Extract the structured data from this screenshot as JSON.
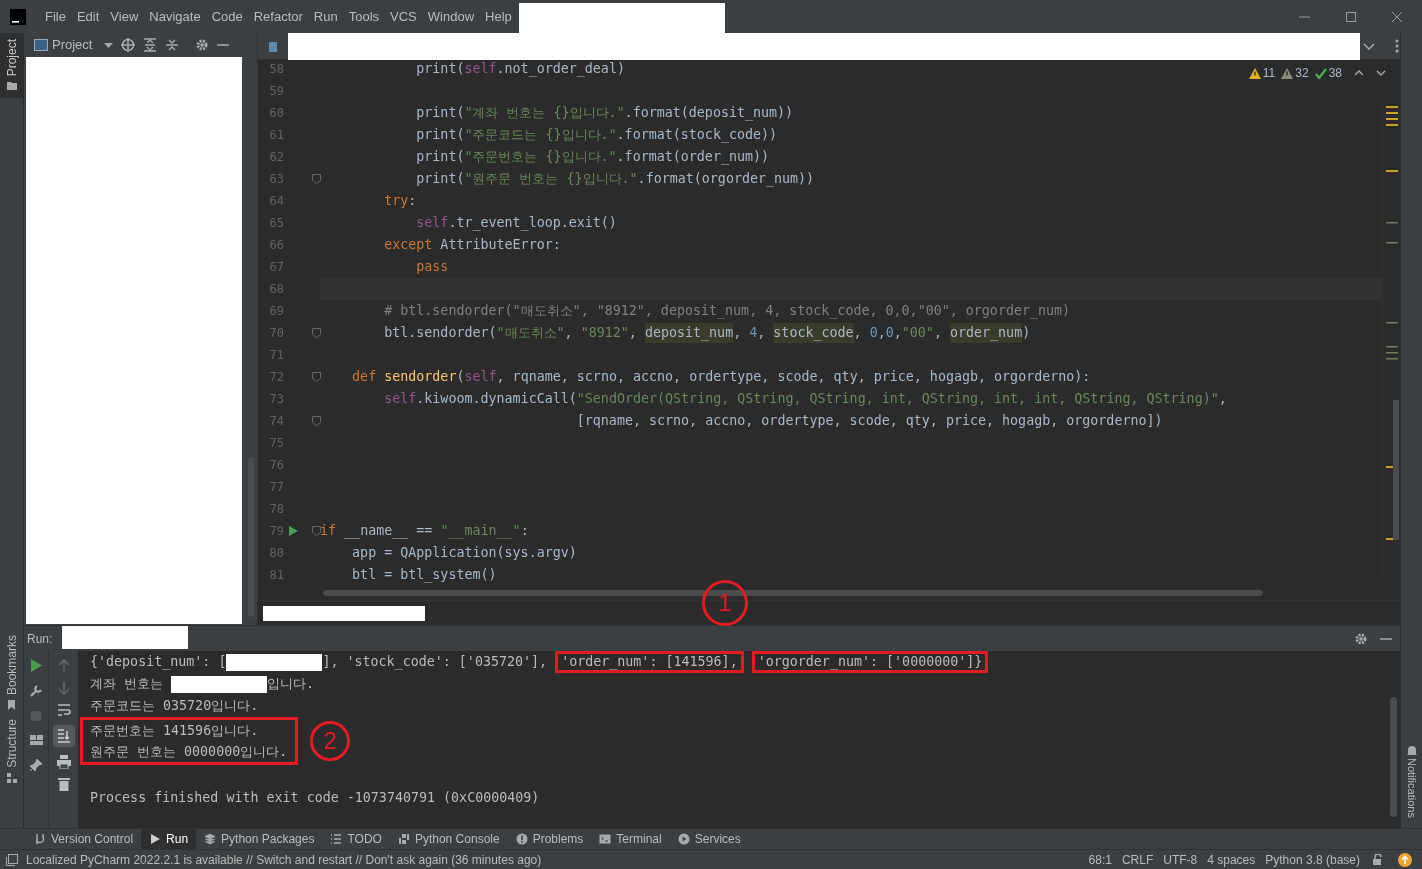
{
  "menu": [
    {
      "label": "File"
    },
    {
      "label": "Edit"
    },
    {
      "label": "View"
    },
    {
      "label": "Navigate"
    },
    {
      "label": "Code"
    },
    {
      "label": "Refactor"
    },
    {
      "label": "Run"
    },
    {
      "label": "Tools"
    },
    {
      "label": "VCS"
    },
    {
      "label": "Window"
    },
    {
      "label": "Help"
    }
  ],
  "left_tabs": [
    {
      "label": "Project",
      "selected": true
    }
  ],
  "left_bottom_tabs": [
    {
      "label": "Bookmarks",
      "selected": false
    },
    {
      "label": "Structure",
      "selected": false
    }
  ],
  "right_tabs": [
    {
      "label": "Notifications",
      "selected": false
    }
  ],
  "project_panel": {
    "title": "Project"
  },
  "inspections": [
    {
      "kind": "warning",
      "count": "11",
      "color": "#e0b020"
    },
    {
      "kind": "weak",
      "count": "32",
      "color": "#8c8a78"
    },
    {
      "kind": "typo",
      "count": "38",
      "color": "#4caf50"
    }
  ],
  "code_lines": [
    {
      "number": "58",
      "fold": false,
      "run": false,
      "current": false,
      "tokens": [
        {
          "kind": "plain",
          "text": "            print("
        },
        {
          "kind": "self",
          "text": "self"
        },
        {
          "kind": "plain",
          "text": ".not_order_deal)"
        }
      ]
    },
    {
      "number": "59",
      "fold": false,
      "run": false,
      "current": false
    },
    {
      "number": "60",
      "fold": false,
      "run": false,
      "current": false,
      "tokens": [
        {
          "kind": "plain",
          "text": "            print("
        },
        {
          "kind": "str",
          "text": "\"계좌 번호는 {}입니다.\""
        },
        {
          "kind": "plain",
          "text": ".format(deposit_num))"
        }
      ]
    },
    {
      "number": "61",
      "fold": false,
      "run": false,
      "current": false,
      "tokens": [
        {
          "kind": "plain",
          "text": "            print("
        },
        {
          "kind": "str",
          "text": "\"주문코드는 {}입니다.\""
        },
        {
          "kind": "plain",
          "text": ".format(stock_code))"
        }
      ]
    },
    {
      "number": "62",
      "fold": false,
      "run": false,
      "current": false,
      "tokens": [
        {
          "kind": "plain",
          "text": "            print("
        },
        {
          "kind": "str",
          "text": "\"주문번호는 {}입니다.\""
        },
        {
          "kind": "plain",
          "text": ".format(order_num))"
        }
      ]
    },
    {
      "number": "63",
      "fold": true,
      "run": false,
      "current": false,
      "tokens": [
        {
          "kind": "plain",
          "text": "            print("
        },
        {
          "kind": "str",
          "text": "\"원주문 번호는 {}입니다.\""
        },
        {
          "kind": "plain",
          "text": ".format(orgorder_num))"
        }
      ]
    },
    {
      "number": "64",
      "fold": false,
      "run": false,
      "current": false,
      "tokens": [
        {
          "kind": "kw",
          "text": "        try"
        },
        {
          "kind": "plain",
          "text": ":"
        }
      ]
    },
    {
      "number": "65",
      "fold": false,
      "run": false,
      "current": false,
      "tokens": [
        {
          "kind": "self",
          "text": "            self"
        },
        {
          "kind": "plain",
          "text": ".tr_event_loop.exit()"
        }
      ]
    },
    {
      "number": "66",
      "fold": false,
      "run": false,
      "current": false,
      "tokens": [
        {
          "kind": "kw",
          "text": "        except"
        },
        {
          "kind": "plain",
          "text": " AttributeError:"
        }
      ]
    },
    {
      "number": "67",
      "fold": false,
      "run": false,
      "current": false,
      "tokens": [
        {
          "kind": "kw",
          "text": "            pass"
        }
      ]
    },
    {
      "number": "68",
      "fold": false,
      "run": false,
      "current": true
    },
    {
      "number": "69",
      "fold": false,
      "run": false,
      "current": false,
      "tokens": [
        {
          "kind": "comment",
          "text": "        # btl.sendorder(\"매도취소\", \"8912\", deposit_num, 4, stock_code, 0,0,\"00\", orgorder_num)"
        }
      ]
    },
    {
      "number": "70",
      "fold": true,
      "run": false,
      "current": false,
      "tokens": [
        {
          "kind": "plain",
          "text": "        btl.sendorder("
        },
        {
          "kind": "str",
          "text": "\"매도취소\""
        },
        {
          "kind": "plain",
          "text": ", "
        },
        {
          "kind": "str",
          "text": "\"8912\""
        },
        {
          "kind": "plain",
          "text": ", "
        },
        {
          "kind": "hl",
          "text": "deposit_num"
        },
        {
          "kind": "plain",
          "text": ", "
        },
        {
          "kind": "num",
          "text": "4"
        },
        {
          "kind": "plain",
          "text": ", "
        },
        {
          "kind": "hl",
          "text": "stock_code"
        },
        {
          "kind": "plain",
          "text": ", "
        },
        {
          "kind": "num",
          "text": "0"
        },
        {
          "kind": "plain",
          "text": ","
        },
        {
          "kind": "num",
          "text": "0"
        },
        {
          "kind": "plain",
          "text": ","
        },
        {
          "kind": "str",
          "text": "\"00\""
        },
        {
          "kind": "plain",
          "text": ", "
        },
        {
          "kind": "hl",
          "text": "order_num"
        },
        {
          "kind": "plain",
          "text": ")"
        }
      ]
    },
    {
      "number": "71",
      "fold": false,
      "run": false,
      "current": false
    },
    {
      "number": "72",
      "fold": true,
      "run": false,
      "current": false,
      "tokens": [
        {
          "kind": "kw",
          "text": "    def"
        },
        {
          "kind": "fn",
          "text": " sendorder"
        },
        {
          "kind": "plain",
          "text": "("
        },
        {
          "kind": "self",
          "text": "self"
        },
        {
          "kind": "plain",
          "text": ", rqname, scrno, accno, ordertype, scode, qty, price, hogagb, orgorderno):"
        }
      ]
    },
    {
      "number": "73",
      "fold": false,
      "run": false,
      "current": false,
      "tokens": [
        {
          "kind": "self",
          "text": "        self"
        },
        {
          "kind": "plain",
          "text": ".kiwoom.dynamicCall("
        },
        {
          "kind": "str",
          "text": "\"SendOrder(QString, QString, QString, int, QString, int, int, QString, QString)\""
        },
        {
          "kind": "plain",
          "text": ","
        }
      ]
    },
    {
      "number": "74",
      "fold": true,
      "run": false,
      "current": false,
      "tokens": [
        {
          "kind": "plain",
          "text": "                                [rqname, scrno, accno, ordertype, scode, qty, price, hogagb, orgorderno])"
        }
      ]
    },
    {
      "number": "75",
      "fold": false,
      "run": false,
      "current": false
    },
    {
      "number": "76",
      "fold": false,
      "run": false,
      "current": false
    },
    {
      "number": "77",
      "fold": false,
      "run": false,
      "current": false
    },
    {
      "number": "78",
      "fold": false,
      "run": false,
      "current": false
    },
    {
      "number": "79",
      "fold": true,
      "run": true,
      "current": false,
      "tokens": [
        {
          "kind": "kw",
          "text": "if"
        },
        {
          "kind": "plain",
          "text": " __name__ == "
        },
        {
          "kind": "str",
          "text": "\"__main__\""
        },
        {
          "kind": "plain",
          "text": ":"
        }
      ]
    },
    {
      "number": "80",
      "fold": false,
      "run": false,
      "current": false,
      "tokens": [
        {
          "kind": "plain",
          "text": "    app = QApplication(sys.argv)"
        }
      ]
    },
    {
      "number": "81",
      "fold": false,
      "run": false,
      "current": false,
      "tokens": [
        {
          "kind": "plain",
          "text": "    btl = btl_system()"
        }
      ]
    }
  ],
  "run_panel": {
    "label": "Run:"
  },
  "console": [
    {
      "kind": "line",
      "tokens": [
        {
          "kind": "plain",
          "text": "{'deposit_num': ["
        },
        {
          "kind": "redacted"
        },
        {
          "kind": "plain",
          "text": "], 'stock_code': ['035720'], "
        },
        {
          "kind": "boxed",
          "text": "'order_num': [141596],"
        },
        {
          "kind": "boxed",
          "text": "'orgorder_num': ['0000000']}"
        }
      ]
    },
    {
      "kind": "line",
      "tokens": [
        {
          "kind": "plain",
          "text": "계좌 번호는 "
        },
        {
          "kind": "redacted"
        },
        {
          "kind": "plain",
          "text": "입니다."
        }
      ]
    },
    {
      "kind": "line",
      "tokens": [
        {
          "kind": "plain",
          "text": "주문코드는 035720입니다."
        }
      ]
    },
    {
      "kind": "boxed",
      "lines": [
        "주문번호는 141596입니다.",
        "원주문 번호는 0000000입니다."
      ]
    },
    {
      "kind": "blank"
    },
    {
      "kind": "line",
      "tokens": [
        {
          "kind": "plain",
          "text": "Process finished with exit code -1073740791 (0xC0000409)"
        }
      ]
    }
  ],
  "callouts": [
    {
      "label": "1"
    },
    {
      "label": "2"
    }
  ],
  "tool_tabs": [
    {
      "label": "Version Control",
      "selected": false
    },
    {
      "label": "Run",
      "selected": true
    },
    {
      "label": "Python Packages",
      "selected": false
    },
    {
      "label": "TODO",
      "selected": false
    },
    {
      "label": "Python Console",
      "selected": false
    },
    {
      "label": "Problems",
      "selected": false
    },
    {
      "label": "Terminal",
      "selected": false
    },
    {
      "label": "Services",
      "selected": false
    }
  ],
  "status_bar": {
    "message": "Localized PyCharm 2022.2.1 is available // Switch and restart // Don't ask again (36 minutes ago)",
    "items": [
      "68:1",
      "CRLF",
      "UTF-8",
      "4 spaces",
      "Python 3.8 (base)"
    ]
  }
}
